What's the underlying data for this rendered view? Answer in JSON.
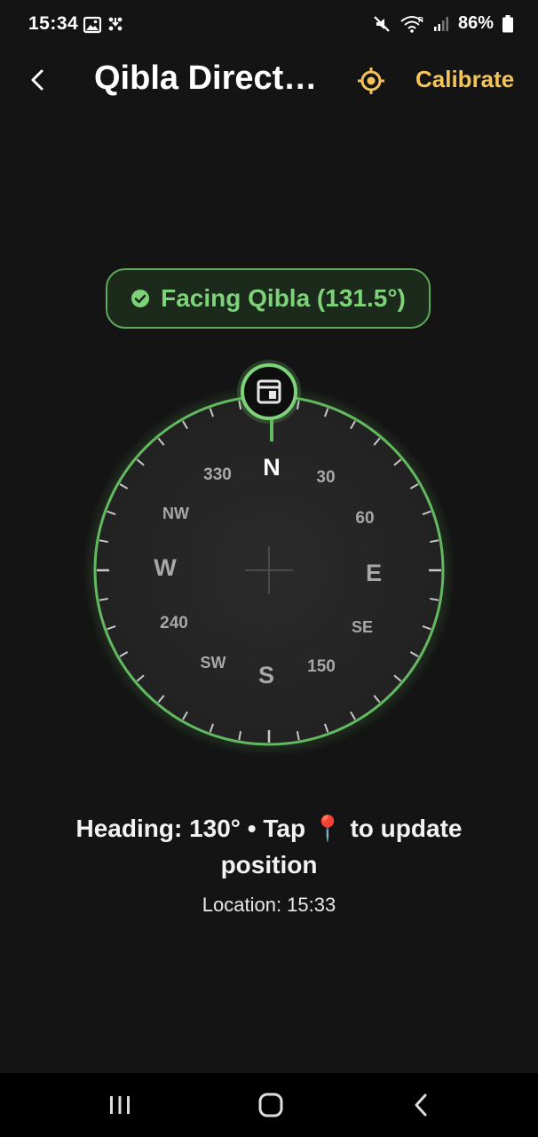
{
  "status_bar": {
    "time": "15:34",
    "battery_percent": "86%",
    "icons": [
      "gallery-icon",
      "download-icon",
      "mute-icon",
      "wifi-icon",
      "signal-icon",
      "battery-icon"
    ]
  },
  "app_bar": {
    "title": "Qibla Direct…",
    "calibrate_label": "Calibrate",
    "accent_color": "#f2c45a"
  },
  "status": {
    "text": "Facing Qibla (131.5°)",
    "color": "#7dd27a"
  },
  "compass": {
    "cardinals": [
      "N",
      "E",
      "S",
      "W"
    ],
    "intercardinals": [
      "NW",
      "SE",
      "SW"
    ],
    "degree_labels": [
      "330",
      "30",
      "60",
      "240",
      "150"
    ],
    "qibla_marker_icon": "kaaba-icon",
    "ring_color": "#63b95f"
  },
  "info": {
    "heading_text": "Heading: 130° • Tap 📍 to update position",
    "location_text": "Location: 15:33"
  },
  "nav_bar": {
    "icons": [
      "recent-apps-icon",
      "home-icon",
      "back-icon"
    ]
  }
}
